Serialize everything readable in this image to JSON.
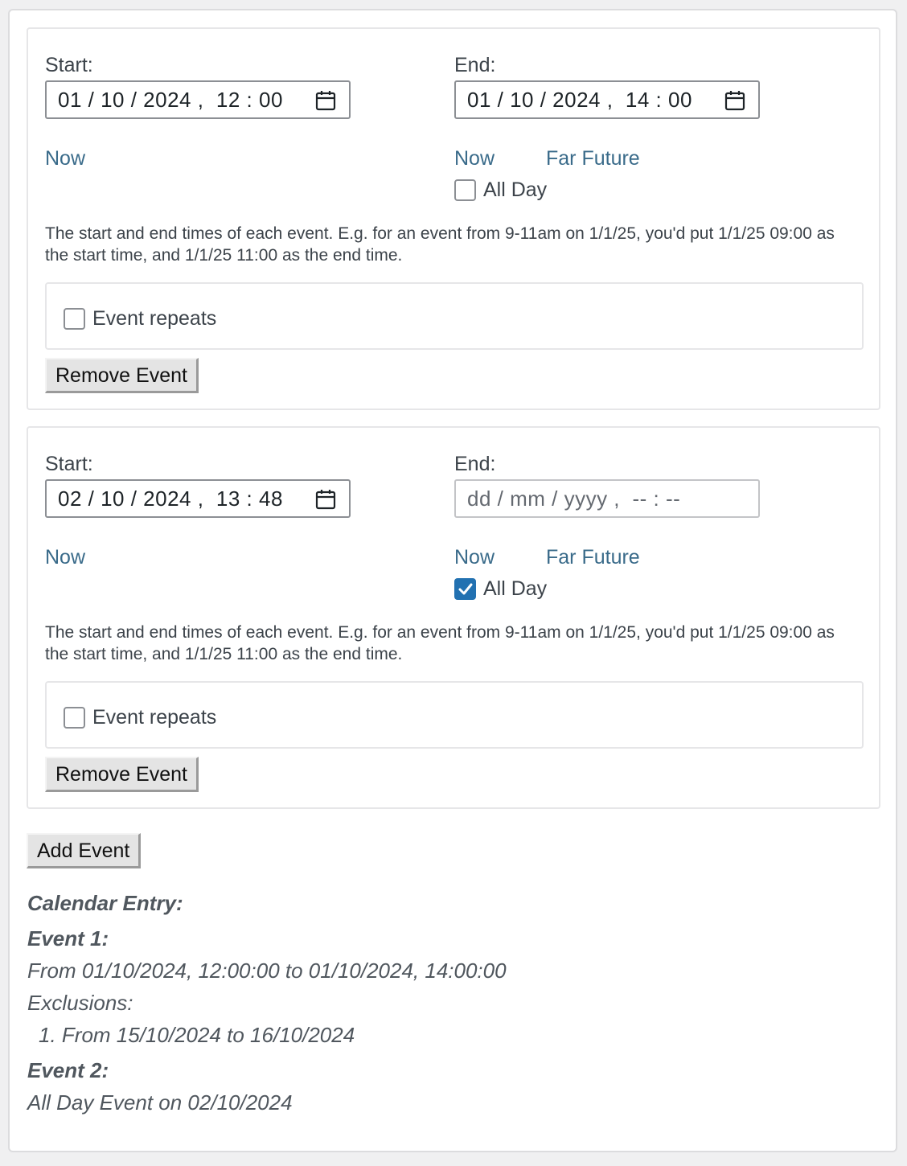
{
  "events": [
    {
      "start_label": "Start:",
      "start_value": "01 / 10 / 2024 ,  12 : 00",
      "end_label": "End:",
      "end_value": "01 / 10 / 2024 ,  14 : 00",
      "start_now": "Now",
      "end_now": "Now",
      "far_future": "Far Future",
      "all_day_label": "All Day",
      "all_day_checked": false,
      "description": "The start and end times of each event. E.g. for an event from 9-11am on 1/1/25, you'd put 1/1/25 09:00 as the start time, and 1/1/25 11:00 as the end time.",
      "repeats_label": "Event repeats",
      "remove_label": "Remove Event"
    },
    {
      "start_label": "Start:",
      "start_value": "02 / 10 / 2024 ,  13 : 48",
      "end_label": "End:",
      "end_value": "dd / mm / yyyy ,  -- : --",
      "start_now": "Now",
      "end_now": "Now",
      "far_future": "Far Future",
      "all_day_label": "All Day",
      "all_day_checked": true,
      "description": "The start and end times of each event. E.g. for an event from 9-11am on 1/1/25, you'd put 1/1/25 09:00 as the start time, and 1/1/25 11:00 as the end time.",
      "repeats_label": "Event repeats",
      "remove_label": "Remove Event"
    }
  ],
  "add_event_label": "Add Event",
  "summary": {
    "heading": "Calendar Entry:",
    "event1_title": "Event 1:",
    "event1_range": "From 01/10/2024, 12:00:00 to 01/10/2024, 14:00:00",
    "exclusions_label": "Exclusions:",
    "exclusion1": "1. From 15/10/2024 to 16/10/2024",
    "event2_title": "Event 2:",
    "event2_text": "All Day Event on 02/10/2024"
  },
  "colors": {
    "link": "#3a6b8a",
    "checkbox_checked": "#2271b1"
  }
}
